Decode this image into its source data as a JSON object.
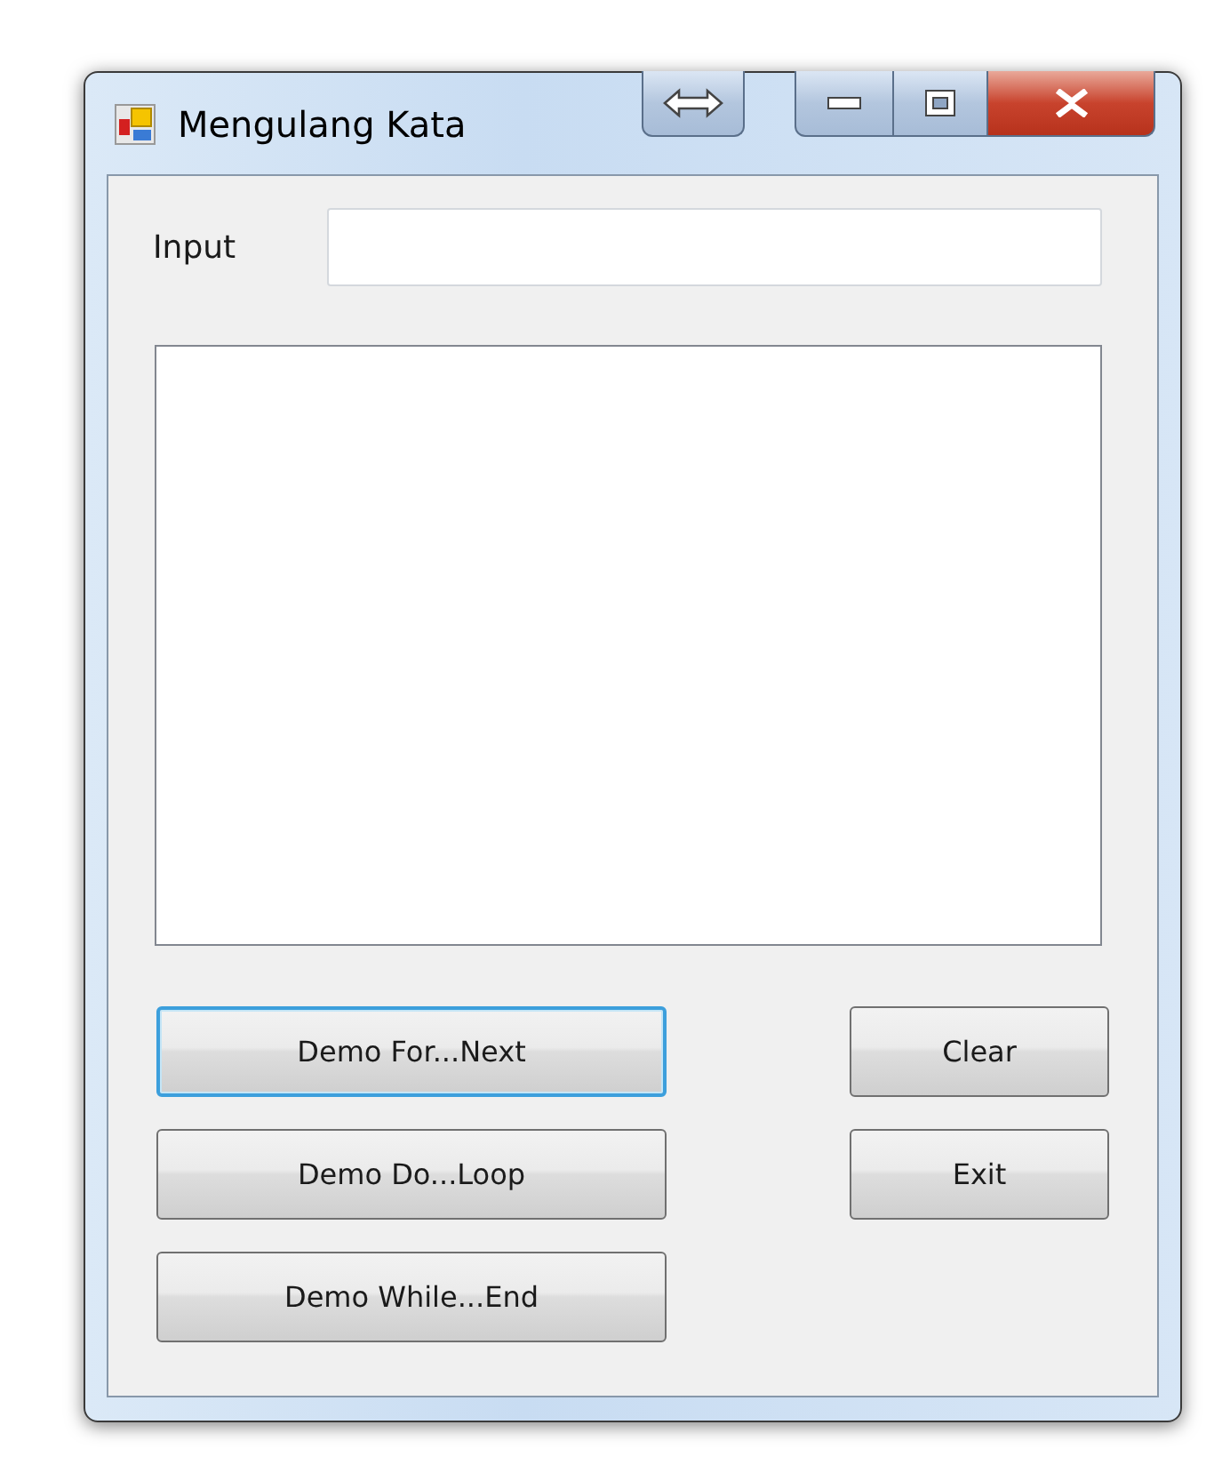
{
  "window": {
    "title": "Mengulang Kata"
  },
  "input": {
    "label": "Input"
  },
  "buttons_left": [
    {
      "label": "Demo For...Next",
      "focused": true
    },
    {
      "label": "Demo Do...Loop",
      "focused": false
    },
    {
      "label": "Demo While...End",
      "focused": false
    }
  ],
  "buttons_right": [
    {
      "label": "Clear",
      "focused": false
    },
    {
      "label": "Exit",
      "focused": false
    }
  ]
}
